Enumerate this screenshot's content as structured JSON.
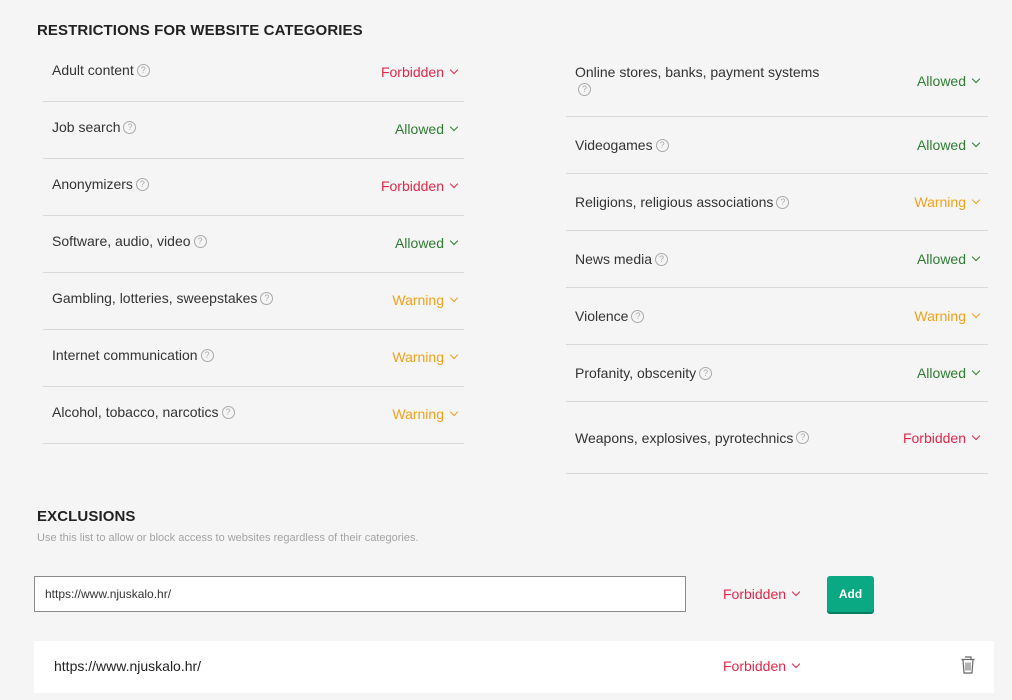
{
  "restrictions": {
    "title": "RESTRICTIONS FOR WEBSITE CATEGORIES",
    "left": [
      {
        "label": "Adult content",
        "status": "Forbidden"
      },
      {
        "label": "Job search",
        "status": "Allowed"
      },
      {
        "label": "Anonymizers",
        "status": "Forbidden"
      },
      {
        "label": "Software, audio, video",
        "status": "Allowed"
      },
      {
        "label": "Gambling, lotteries, sweepstakes",
        "status": "Warning"
      },
      {
        "label": "Internet communication",
        "status": "Warning"
      },
      {
        "label": "Alcohol, tobacco, narcotics",
        "status": "Warning"
      }
    ],
    "right": [
      {
        "label": "Online stores, banks, payment systems",
        "status": "Allowed"
      },
      {
        "label": "Videogames",
        "status": "Allowed"
      },
      {
        "label": "Religions, religious associations",
        "status": "Warning"
      },
      {
        "label": "News media",
        "status": "Allowed"
      },
      {
        "label": "Violence",
        "status": "Warning"
      },
      {
        "label": "Profanity, obscenity",
        "status": "Allowed"
      },
      {
        "label": "Weapons, explosives, pyrotechnics",
        "status": "Forbidden"
      }
    ]
  },
  "exclusions": {
    "title": "EXCLUSIONS",
    "description": "Use this list to allow or block access to websites regardless of their categories.",
    "input_value": "https://www.njuskalo.hr/",
    "new_status": "Forbidden",
    "add_label": "Add",
    "items": [
      {
        "url": "https://www.njuskalo.hr/",
        "status": "Forbidden"
      }
    ]
  },
  "colors": {
    "forbidden": "#e3274a",
    "allowed": "#2e7d32",
    "warning": "#f0a11c",
    "add_button": "#0aa883"
  },
  "icons": {
    "help": "question-circle-icon",
    "dropdown": "chevron-down-icon",
    "delete": "trash-icon"
  }
}
